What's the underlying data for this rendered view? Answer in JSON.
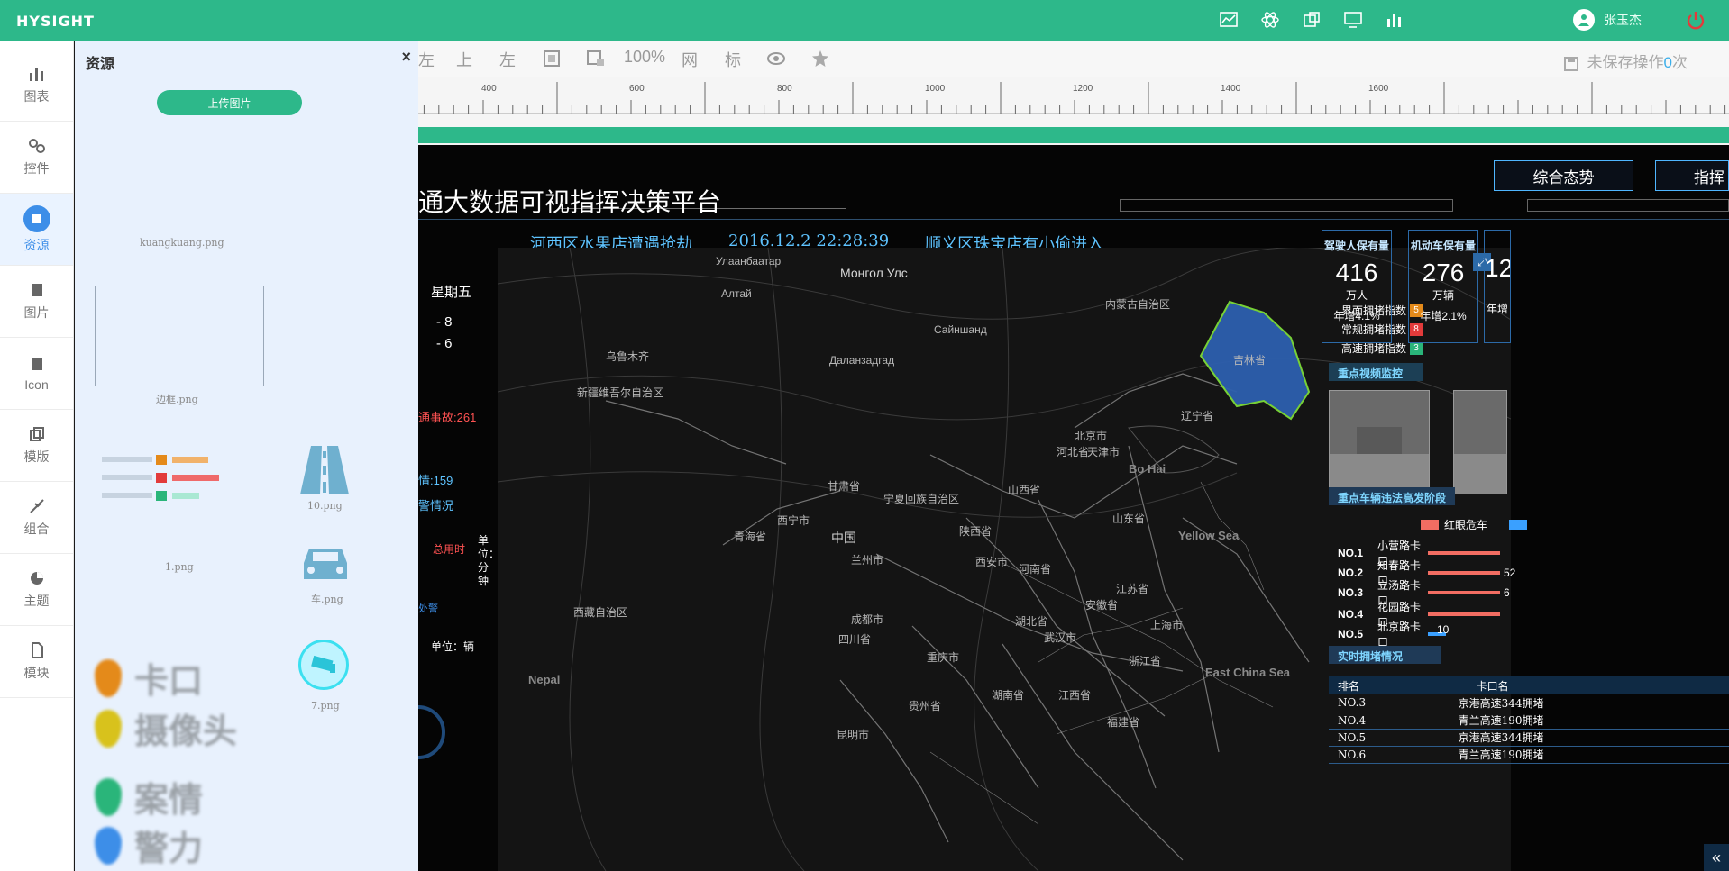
{
  "app": {
    "logo": "HYSIGHT"
  },
  "user": {
    "name": "张玉杰"
  },
  "nav": [
    {
      "label": "图表"
    },
    {
      "label": "控件"
    },
    {
      "label": "资源"
    },
    {
      "label": "图片"
    },
    {
      "label": "Icon"
    },
    {
      "label": "模版"
    },
    {
      "label": "组合"
    },
    {
      "label": "主题"
    },
    {
      "label": "模块"
    }
  ],
  "panel": {
    "title": "资源",
    "close": "×",
    "upload_label": "上传图片",
    "files": {
      "kuangkuang": "kuangkuang.png",
      "biankuang": "边框.png",
      "one": "1.png",
      "ten": "10.png",
      "car": "车.png",
      "seven": "7.png"
    },
    "legend_words": [
      "卡口",
      "摄像头",
      "案情",
      "警力"
    ]
  },
  "toolbar": {
    "items": [
      "左",
      "上",
      "左",
      "100%",
      "网",
      "标"
    ],
    "unsaved_prefix": "未保存操作",
    "unsaved_count": "0",
    "unsaved_suffix": "次"
  },
  "ruler": {
    "ticks": [
      "400",
      "600",
      "800",
      "1000",
      "1200",
      "1400",
      "1600"
    ]
  },
  "dashboard": {
    "title": "通大数据可视指挥决策平台",
    "marquee": [
      "河西区水果店遭遇抢劫",
      "2016.12.2  22:28:39",
      "顺义区珠宝店有小偷进入"
    ],
    "tabs": [
      "综合态势",
      "指挥"
    ],
    "left": {
      "weekday": "星期五",
      "d1": "- 8",
      "d2": "- 6",
      "accidents": "通事故:261",
      "cases": "情:159",
      "police": "警情况",
      "total_time": "总用时",
      "unit_minutes": "单位：分钟",
      "unit_vehicle": "单位：辆",
      "alarm": "处警"
    },
    "map_legend": [
      {
        "label": "界面拥堵指数",
        "value": "5",
        "color": "#e48a1a"
      },
      {
        "label": "常规拥堵指数",
        "value": "8",
        "color": "#e23b3b"
      },
      {
        "label": "高速拥堵指数",
        "value": "3",
        "color": "#2ab57a"
      }
    ],
    "map_labels": {
      "mongolia": "Монгол Улс",
      "china": "中国",
      "yellow_sea": "Yellow Sea",
      "bo_hai": "Bo Hai",
      "east_china_sea": "East China Sea",
      "nepal": "Nepal",
      "xinjiang": "新疆维吾尔自治区",
      "xizang": "西藏自治区",
      "qinghai": "青海省",
      "gansu": "甘肃省",
      "ningxia": "宁夏回族自治区",
      "neimenggu": "内蒙古自治区",
      "shanxi": "山西省",
      "shaanxi": "陕西省",
      "henan": "河南省",
      "hubei": "湖北省",
      "hunan": "湖南省",
      "sichuan": "四川省",
      "chongqing": "重庆市",
      "guizhou": "贵州省",
      "jiangxi": "江西省",
      "zhejiang": "浙江省",
      "anhui": "安徽省",
      "jiangsu": "江苏省",
      "shandong": "山东省",
      "beijing": "北京市",
      "tianjin": "天津市",
      "hebei": "河北省",
      "liaoning": "辽宁省",
      "jilin": "吉林省",
      "shanghai": "上海市",
      "fujian": "福建省",
      "wulumuqi": "乌鲁木齐",
      "lanzhou": "兰州市",
      "xian": "西安市",
      "wuhan": "武汉市",
      "chengdu": "成都市",
      "kunming": "昆明市",
      "xining": "西宁市",
      "ulaanbaatar": "Улаанбаатар",
      "altai": "Алтай",
      "dalanzadgad": "Даланзадгад",
      "sainshand": "Сайншанд"
    },
    "stats": [
      {
        "label": "驾驶人保有量",
        "value": "416",
        "unit": "万人",
        "growth": "年增4.1%"
      },
      {
        "label": "机动车保有量",
        "value": "276",
        "unit": "万辆",
        "growth": "年增2.1%"
      },
      {
        "label": "",
        "value": "12",
        "unit": "",
        "growth": "年增"
      }
    ],
    "sections": {
      "video": "重点视频监控",
      "violations": "重点车辆违法高发阶段",
      "congestion": "实时拥堵情况"
    },
    "violation_legend": "红眼危车",
    "ranking": [
      {
        "rank": "NO.1",
        "name": "小营路卡口",
        "value": ""
      },
      {
        "rank": "NO.2",
        "name": "知春路卡口",
        "value": "52"
      },
      {
        "rank": "NO.3",
        "name": "立汤路卡口",
        "value": "6"
      },
      {
        "rank": "NO.4",
        "name": "花园路卡口",
        "value": ""
      },
      {
        "rank": "NO.5",
        "name": "北京路卡口",
        "value": "10"
      }
    ],
    "table": {
      "headers": [
        "排名",
        "卡口名"
      ],
      "rows": [
        [
          "NO.3",
          "京港高速344拥堵"
        ],
        [
          "NO.4",
          "青兰高速190拥堵"
        ],
        [
          "NO.5",
          "京港高速344拥堵"
        ],
        [
          "NO.6",
          "青兰高速190拥堵"
        ]
      ]
    }
  },
  "colors": {
    "brand": "#2db88a",
    "accent": "#3d8ee8",
    "stage": "#050505"
  }
}
